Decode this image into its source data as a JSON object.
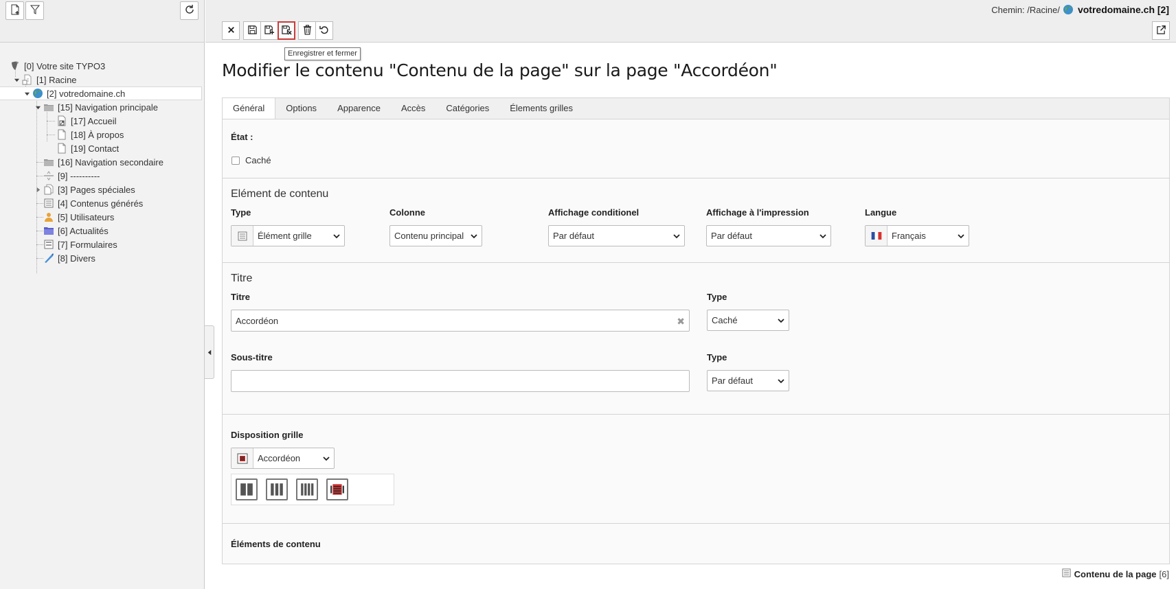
{
  "tree_toolbar": {
    "new_page_icon": "new-page-icon",
    "filter_icon": "filter-icon",
    "refresh_icon": "refresh-icon"
  },
  "tree": {
    "nodes": [
      {
        "label": "[0] Votre site TYPO3",
        "icon": "typo3-icon"
      },
      {
        "label": "[1] Racine",
        "icon": "page-root-icon"
      },
      {
        "label": "[2] votredomaine.ch",
        "icon": "globe-icon"
      },
      {
        "label": "[15] Navigation principale",
        "icon": "folder-icon"
      },
      {
        "label": "[17] Accueil",
        "icon": "page-shortcut-icon"
      },
      {
        "label": "[18] À propos",
        "icon": "page-icon"
      },
      {
        "label": "[19] Contact",
        "icon": "page-icon"
      },
      {
        "label": "[16] Navigation secondaire",
        "icon": "folder-icon"
      },
      {
        "label": "[9] ----------",
        "icon": "separator-icon"
      },
      {
        "label": "[3] Pages spéciales",
        "icon": "pages-icon"
      },
      {
        "label": "[4] Contenus générés",
        "icon": "content-icon"
      },
      {
        "label": "[5] Utilisateurs",
        "icon": "users-icon"
      },
      {
        "label": "[6] Actualités",
        "icon": "news-folder-icon"
      },
      {
        "label": "[7] Formulaires",
        "icon": "forms-icon"
      },
      {
        "label": "[8] Divers",
        "icon": "misc-icon"
      }
    ]
  },
  "header": {
    "path_prefix": "Chemin: /Racine/",
    "path_page": "votredomaine.ch [2]",
    "tooltip": "Enregistrer et fermer"
  },
  "page_title": "Modifier le contenu \"Contenu de la page\" sur la page \"Accordéon\"",
  "tabs": [
    {
      "label": "Général"
    },
    {
      "label": "Options"
    },
    {
      "label": "Apparence"
    },
    {
      "label": "Accès"
    },
    {
      "label": "Catégories"
    },
    {
      "label": "Élements grilles"
    }
  ],
  "form": {
    "etat": {
      "label": "État :",
      "hidden_label": "Caché"
    },
    "content_element": {
      "title": "Elément de contenu",
      "type_label": "Type",
      "type_value": "Élément grille",
      "column_label": "Colonne",
      "column_value": "Contenu principal",
      "conditional_label": "Affichage conditionel",
      "conditional_value": "Par défaut",
      "print_label": "Affichage à l'impression",
      "print_value": "Par défaut",
      "language_label": "Langue",
      "language_value": "Français"
    },
    "titre": {
      "title": "Titre",
      "title_label": "Titre",
      "title_value": "Accordéon",
      "title_type_label": "Type",
      "title_type_value": "Caché",
      "subtitle_label": "Sous-titre",
      "subtitle_value": "",
      "subtitle_type_label": "Type",
      "subtitle_type_value": "Par défaut"
    },
    "grid": {
      "label": "Disposition grille",
      "value": "Accordéon"
    },
    "elements": {
      "label": "Éléments de contenu"
    }
  },
  "footer": {
    "record_title": "Contenu de la page",
    "record_uid": "[6]"
  }
}
